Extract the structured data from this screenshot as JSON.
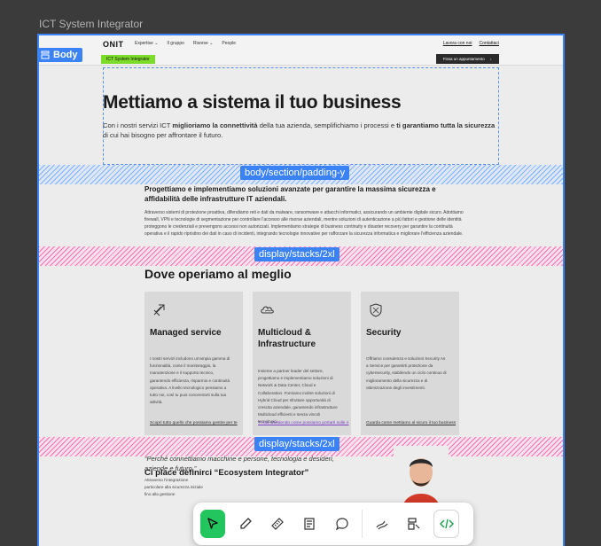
{
  "frame_title": "ICT System Integrator",
  "body_label": "Body",
  "nav": {
    "logo": "ONIT",
    "links": [
      "Expertise ⌄",
      "Il gruppo",
      "Risorse ⌄",
      "People"
    ],
    "right_links": [
      "Lavora con noi",
      "Contattaci"
    ],
    "tag": "ICT System Integrator",
    "cta": "Fissa un appuntamento",
    "cta_arrow": "↓"
  },
  "hero": {
    "title": "Mettiamo a sistema il tuo business",
    "sub_pre": "Con i nostri servizi ICT ",
    "sub_b1": "miglioriamo la connettività",
    "sub_mid": " della tua azienda, semplifichiamo i processi e ",
    "sub_b2": "ti garantiamo tutta la sicurezza",
    "sub_post": " di cui hai bisogno per affrontare il futuro."
  },
  "overlays": {
    "padding": "body/section/padding-y",
    "stacks1": "display/stacks/2xl",
    "stacks2": "display/stacks/2xl"
  },
  "section1": {
    "title": "Progettiamo e implementiamo soluzioni avanzate per garantire la massima sicurezza e affidabilità delle infrastrutture IT aziendali.",
    "body": "Attraverso sistemi di protezione proattiva, difendiamo reti e dati da malware, ransomware e attacchi informatici, assicurando un ambiente digitale sicuro. Adottiamo firewall, VPN e tecnologie di segmentazione per controllare l'accesso alle risorse aziendali, mentre soluzioni di autenticazione a più fattori e gestione delle identità proteggono le credenziali e prevengono accessi non autorizzati. Implementiamo strategie di business continuity e disaster recovery per garantire la continuità operativa e il rapido ripristino dei dati in caso di incidenti, integrando tecnologie innovative per rafforzare la sicurezza informatica e migliorare l'efficienza aziendale."
  },
  "section2": {
    "title": "Dove operiamo al meglio",
    "cards": [
      {
        "icon": "arrows-icon",
        "title": "Managed service",
        "body": "I nostri servizi includono un'ampia gamma di funzionalità, come il monitoraggio, la manutenzione e il supporto tecnico, garantendo efficienza, risparmio e continuità operativa. A livello tecnologico pensiamo a tutto noi, così tu puoi concentrarti sulla tua attività.",
        "link": "Scopri tutto quello che possiamo gestire per te"
      },
      {
        "icon": "cloud-icon",
        "title": "Multicloud & Infrastructure",
        "body": "Insieme a partner leader del settore, progettiamo e implementiamo soluzioni di Network & Data Center, Cloud e Collaboration. Forniamo inoltre soluzioni di Hybrid Cloud per sfruttare opportunità di crescita aziendale, garantendo infrastrutture Multicloud efficienti e senza vincoli tecnologici.",
        "link": "Ti stai chiedendo come possiamo portarti sulle n"
      },
      {
        "icon": "shield-icon",
        "title": "Security",
        "body": "Offriamo consulenza e soluzioni Security As a Service per garantirti protezione da cybersecurity, stabilendo un ciclo continuo di miglioramento della sicurezza e di ottimizzazione degli investimenti.",
        "link": "Guarda come mettiamo al sicuro il tuo business"
      }
    ]
  },
  "section3": {
    "title": "Ci piace definirci “Ecosystem Integrator”",
    "quote": "“Perché connettiamo macchine e persone, tecnologia e desideri, aziende e futuro.”",
    "fine": "Attraverso l'integrazione particolare alla sicurezza iniziale fino alla gestione"
  },
  "toolbar": {
    "tools": [
      "pointer-icon",
      "eyedropper-icon",
      "ruler-icon",
      "notes-icon",
      "comment-icon",
      "draw-icon",
      "layers-icon",
      "code-icon"
    ]
  },
  "colors": {
    "selection": "#3b82f6",
    "hatch_blue": "#3b82f6",
    "hatch_pink": "#ec4899",
    "active_tool": "#22c55e",
    "tag": "#7ddc2a"
  }
}
